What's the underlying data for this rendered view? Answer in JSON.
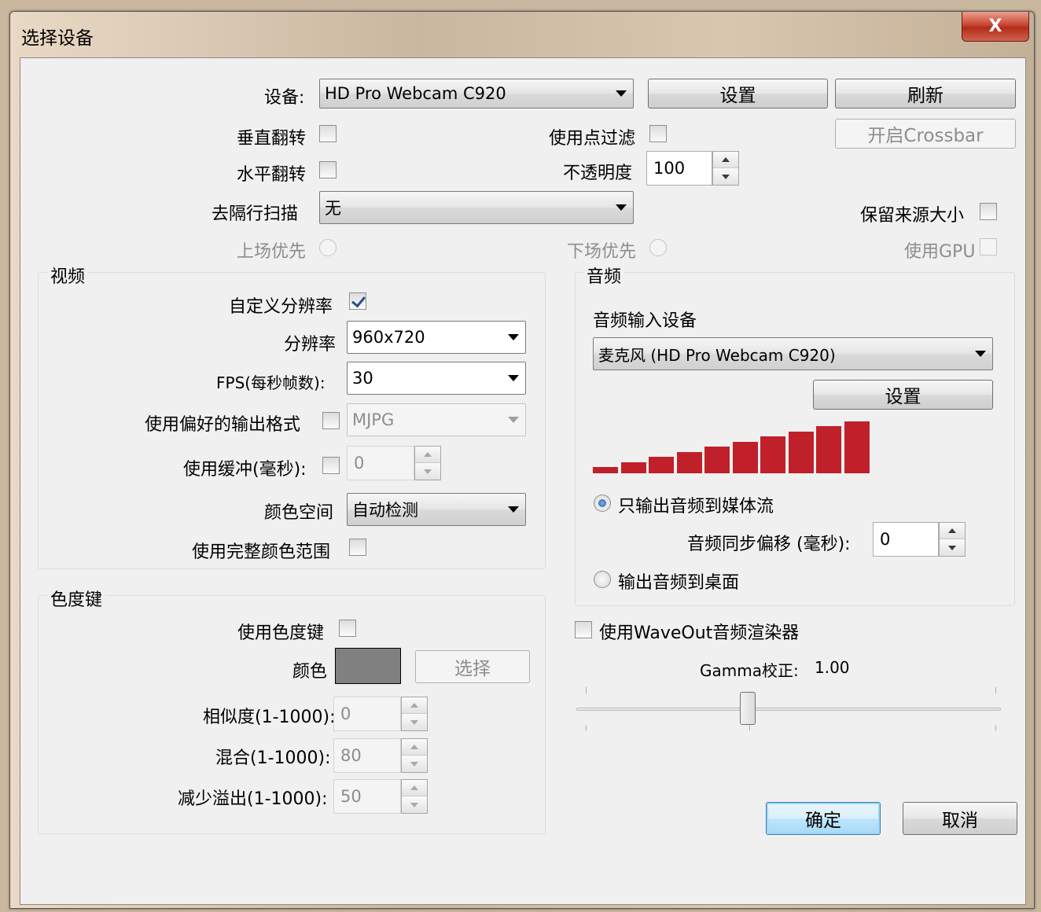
{
  "window": {
    "title": "选择设备",
    "close_glyph": "X"
  },
  "device": {
    "label": "设备:",
    "selected": "HD Pro Webcam C920",
    "config_button": "设置",
    "refresh_button": "刷新",
    "crossbar_button": "开启Crossbar"
  },
  "flip_vertical": {
    "label": "垂直翻转",
    "checked": false
  },
  "flip_horizontal": {
    "label": "水平翻转",
    "checked": false
  },
  "point_filter": {
    "label": "使用点过滤",
    "checked": false
  },
  "opacity": {
    "label": "不透明度",
    "value": "100"
  },
  "deinterlace": {
    "label": "去隔行扫描",
    "selected": "无",
    "top_field_first": "上场优先",
    "bottom_field_first": "下场优先"
  },
  "preserve_source_size": {
    "label": "保留来源大小",
    "checked": false
  },
  "use_gpu": {
    "label": "使用GPU",
    "checked": false
  },
  "video": {
    "group_title": "视频",
    "custom_resolution": {
      "label": "自定义分辨率",
      "checked": true
    },
    "resolution": {
      "label": "分辨率",
      "selected": "960x720"
    },
    "fps": {
      "label": "FPS(每秒帧数):",
      "selected": "30"
    },
    "preferred_format": {
      "label": "使用偏好的输出格式",
      "checked": false,
      "selected": "MJPG"
    },
    "buffer": {
      "label": "使用缓冲(毫秒):",
      "checked": false,
      "value": "0"
    },
    "color_space": {
      "label": "颜色空间",
      "selected": "自动检测"
    },
    "full_range": {
      "label": "使用完整颜色范围",
      "checked": false
    }
  },
  "chroma_key": {
    "group_title": "色度键",
    "use_chroma_key": {
      "label": "使用色度键",
      "checked": false
    },
    "color_label": "颜色",
    "color_value": "#808080",
    "select_button": "选择",
    "similarity": {
      "label": "相似度(1-1000):",
      "value": "0"
    },
    "blend": {
      "label": "混合(1-1000):",
      "value": "80"
    },
    "spill_reduction": {
      "label": "减少溢出(1-1000):",
      "value": "50"
    }
  },
  "audio": {
    "group_title": "音频",
    "input_device_label": "音频输入设备",
    "input_device_selected": "麦克风 (HD Pro Webcam C920)",
    "config_button": "设置",
    "meter_color": "#c0202a",
    "meter_level": 1.0,
    "output_stream_only": {
      "label": "只输出音频到媒体流",
      "selected": true
    },
    "sync_offset": {
      "label": "音频同步偏移 (毫秒):",
      "value": "0"
    },
    "output_desktop": {
      "label": "输出音频到桌面",
      "selected": false
    }
  },
  "waveout": {
    "label": "使用WaveOut音频渲染器",
    "checked": false
  },
  "gamma": {
    "label": "Gamma校正:",
    "value": "1.00",
    "slider_fraction": 0.4
  },
  "footer": {
    "ok_button": "确定",
    "cancel_button": "取消"
  }
}
